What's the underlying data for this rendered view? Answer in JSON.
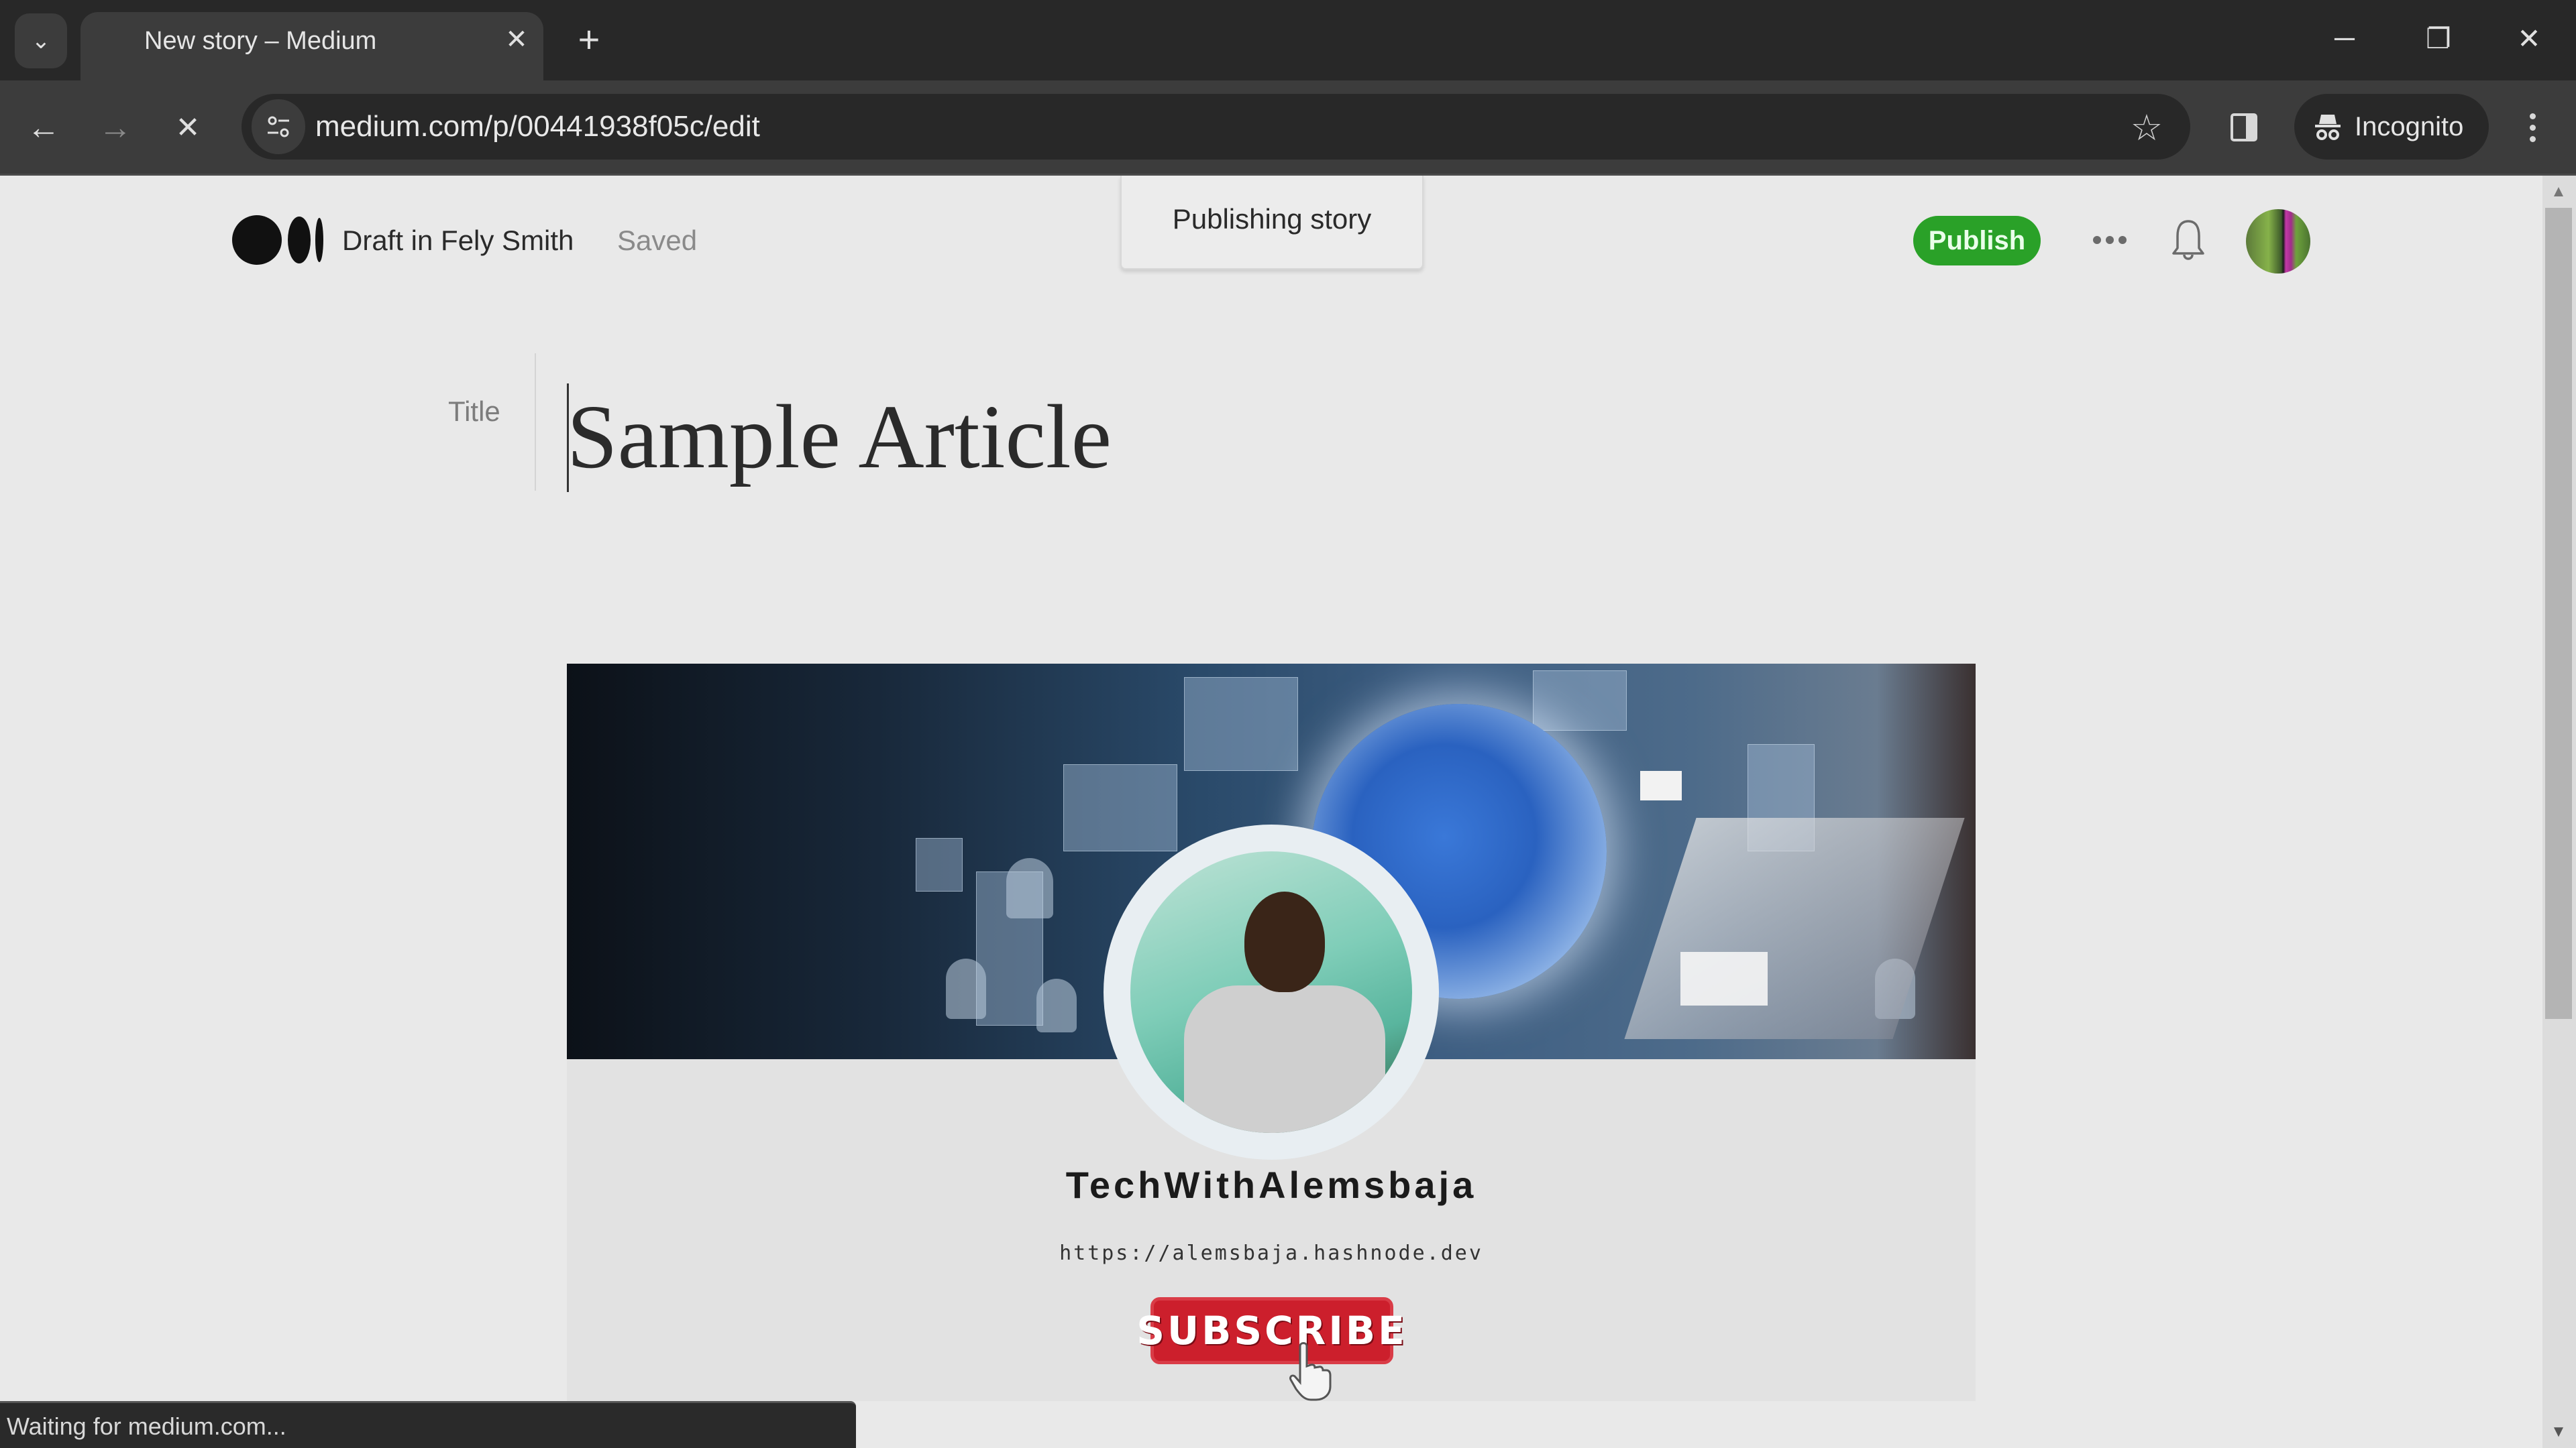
{
  "browser": {
    "tab_title": "New story – Medium",
    "url": "medium.com/p/00441938f05c/edit",
    "profile_label": "Incognito",
    "status_text": "Waiting for medium.com...",
    "icons": {
      "tab_search": "chevron-down-icon",
      "tab_close": "close-icon",
      "new_tab": "plus-icon",
      "back": "arrow-left-icon",
      "forward": "arrow-right-icon",
      "stop": "stop-loading-icon",
      "site_info": "tune-icon",
      "bookmark": "star-icon",
      "side_panel": "side-panel-icon",
      "incognito": "incognito-icon",
      "menu": "kebab-menu-icon"
    },
    "window_controls": {
      "minimize": "─",
      "restore": "❐",
      "close": "✕"
    },
    "glyphs": {
      "chevron": "⌄",
      "close": "✕",
      "plus": "+",
      "back": "←",
      "forward": "→",
      "stop": "✕",
      "star": "☆",
      "scroll_up": "▲",
      "scroll_down": "▼"
    }
  },
  "medium": {
    "draft_label": "Draft in Fely Smith",
    "save_status": "Saved",
    "publishing_tooltip": "Publishing story",
    "publish_button": "Publish",
    "brand_color": "#2aa128"
  },
  "editor": {
    "title_label": "Title",
    "title_text": "Sample Article"
  },
  "image": {
    "channel_name": "TechWithAlemsbaja",
    "channel_url": "https://alemsbaja.hashnode.dev",
    "subscribe_label": "SUBSCRIBE"
  }
}
